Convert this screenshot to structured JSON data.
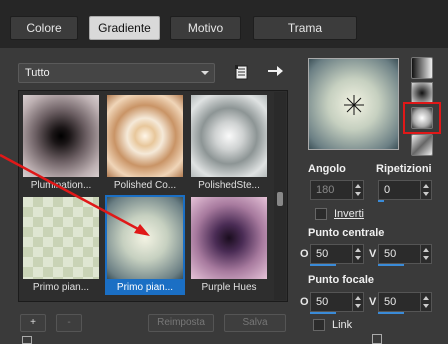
{
  "tabs": [
    {
      "label": "Colore",
      "active": false
    },
    {
      "label": "Gradiente",
      "active": true
    },
    {
      "label": "Motivo",
      "active": false
    },
    {
      "label": "Trama",
      "active": false
    }
  ],
  "category": {
    "selected": "Tutto"
  },
  "gradients": [
    {
      "label": "Plumination..."
    },
    {
      "label": "Polished Co..."
    },
    {
      "label": "PolishedSte..."
    },
    {
      "label": "Primo pian..."
    },
    {
      "label": "Primo pian..."
    },
    {
      "label": "Purple Hues"
    }
  ],
  "buttons": {
    "add": "+",
    "remove": "-",
    "reset": "Reimposta",
    "save": "Salva"
  },
  "angle": {
    "label": "Angolo",
    "value": "180"
  },
  "repeats": {
    "label": "Ripetizioni",
    "value": "0"
  },
  "invert": {
    "label": "Inverti"
  },
  "center_point": {
    "label": "Punto centrale",
    "h_label": "O",
    "h_value": "50",
    "v_label": "V",
    "v_value": "50"
  },
  "focal_point": {
    "label": "Punto focale",
    "h_label": "O",
    "h_value": "50",
    "v_label": "V",
    "v_value": "50"
  },
  "link": {
    "label": "Link"
  },
  "colors": {
    "selection_blue": "#1b6fc4",
    "accent_red": "#e01818",
    "slider_blue": "#3a8bd8"
  }
}
